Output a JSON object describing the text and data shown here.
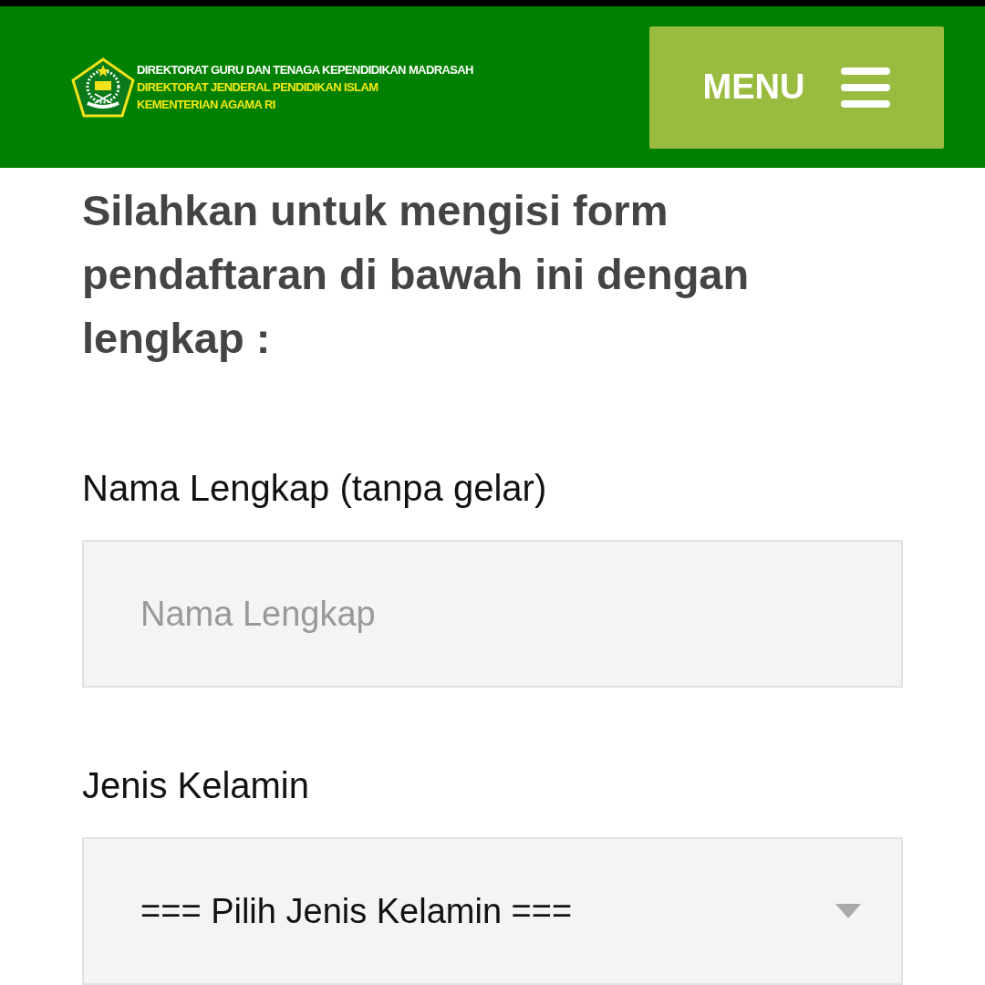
{
  "header": {
    "logo_lines": [
      "DIREKTORAT GURU DAN TENAGA KEPENDIDIKAN MADRASAH",
      "DIREKTORAT JENDERAL PENDIDIKAN ISLAM",
      "KEMENTERIAN AGAMA RI"
    ],
    "menu_button": "MENU"
  },
  "form": {
    "intro": "Silahkan untuk mengisi form pendaftaran di bawah ini dengan lengkap :",
    "fields": [
      {
        "kind": "text",
        "label": "Nama Lengkap (tanpa gelar)",
        "placeholder": "Nama Lengkap"
      },
      {
        "kind": "select",
        "label": "Jenis Kelamin",
        "value": "=== Pilih Jenis Kelamin ==="
      }
    ]
  }
}
